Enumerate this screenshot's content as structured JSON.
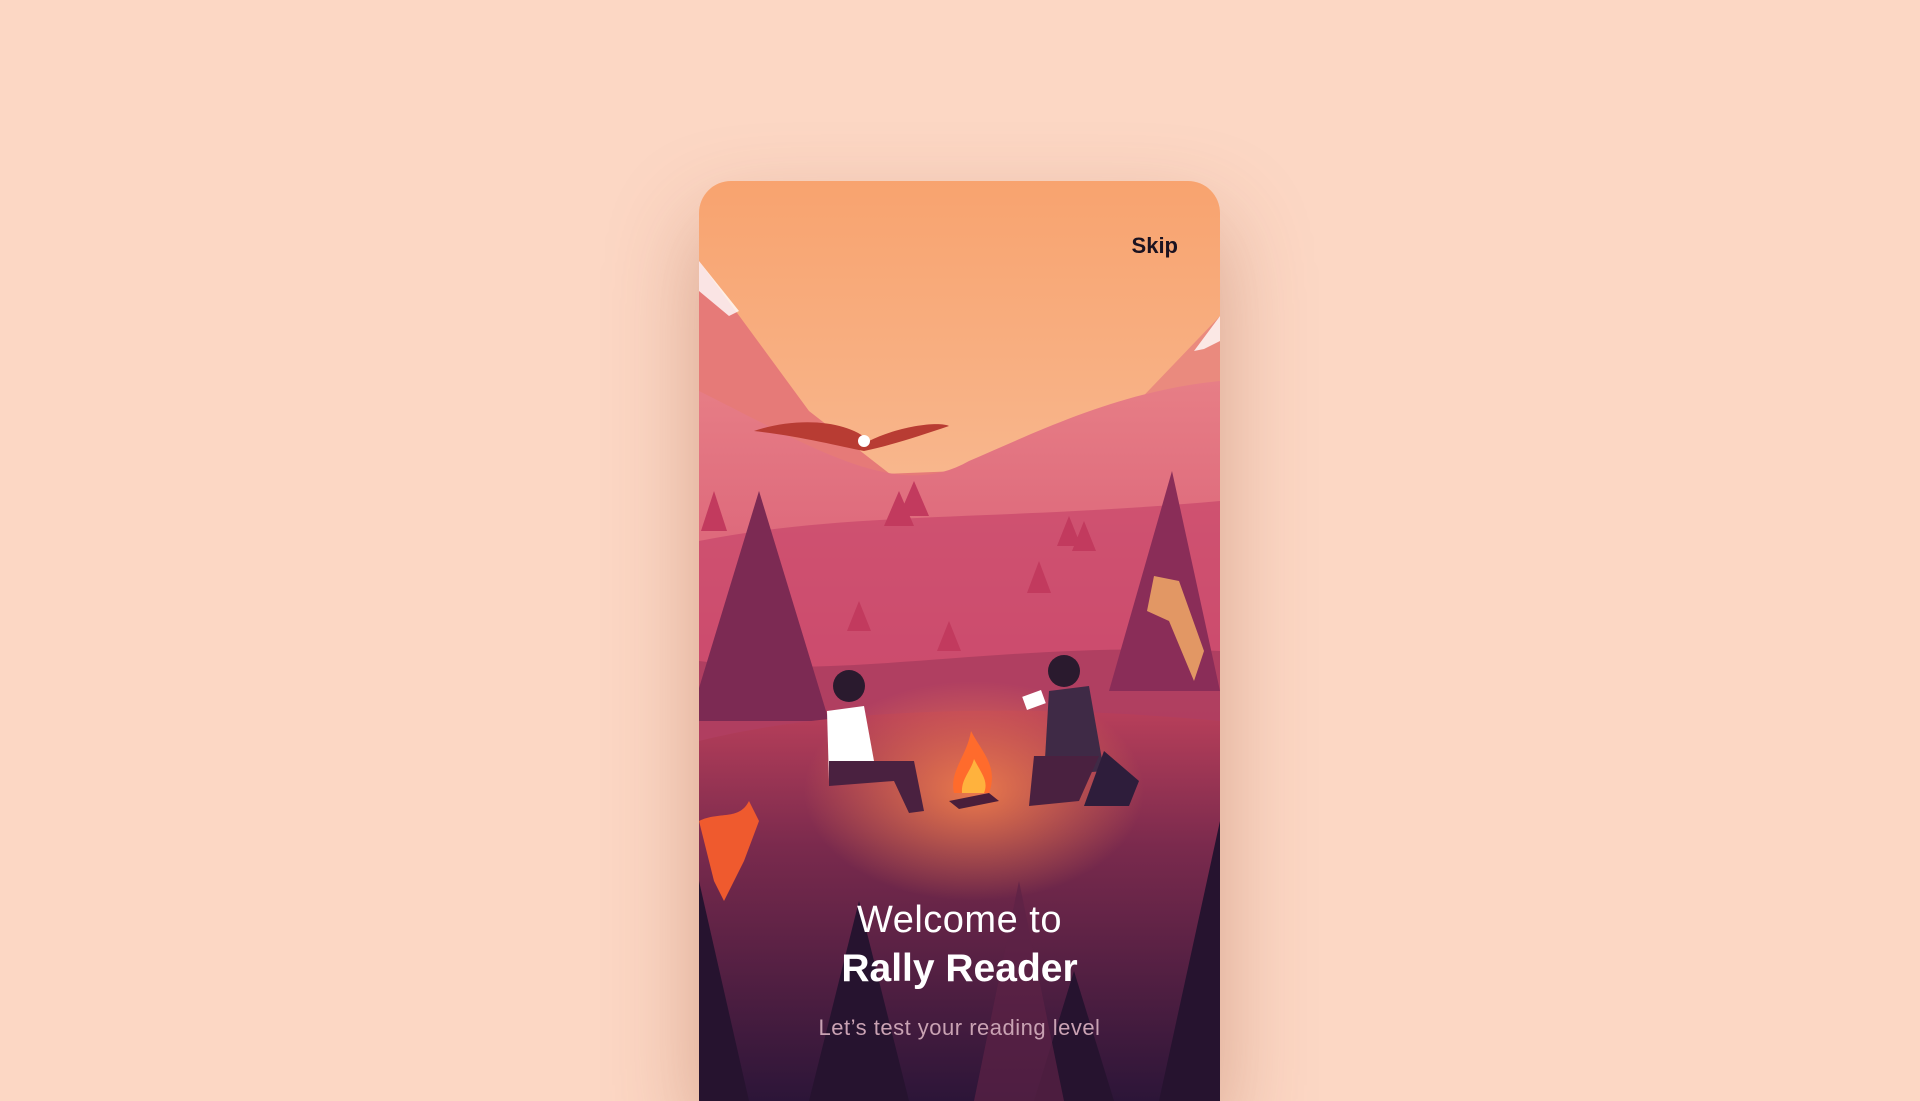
{
  "header": {
    "skip_label": "Skip"
  },
  "welcome": {
    "line1": "Welcome to",
    "app_name": "Rally Reader",
    "subtitle": "Let’s test your reading level"
  },
  "colors": {
    "background": "#fcd7c4",
    "sky_top": "#f8a36f",
    "sky_bottom": "#f6c0a0",
    "valley": "#d8506e",
    "foreground": "#3a1a3e"
  }
}
